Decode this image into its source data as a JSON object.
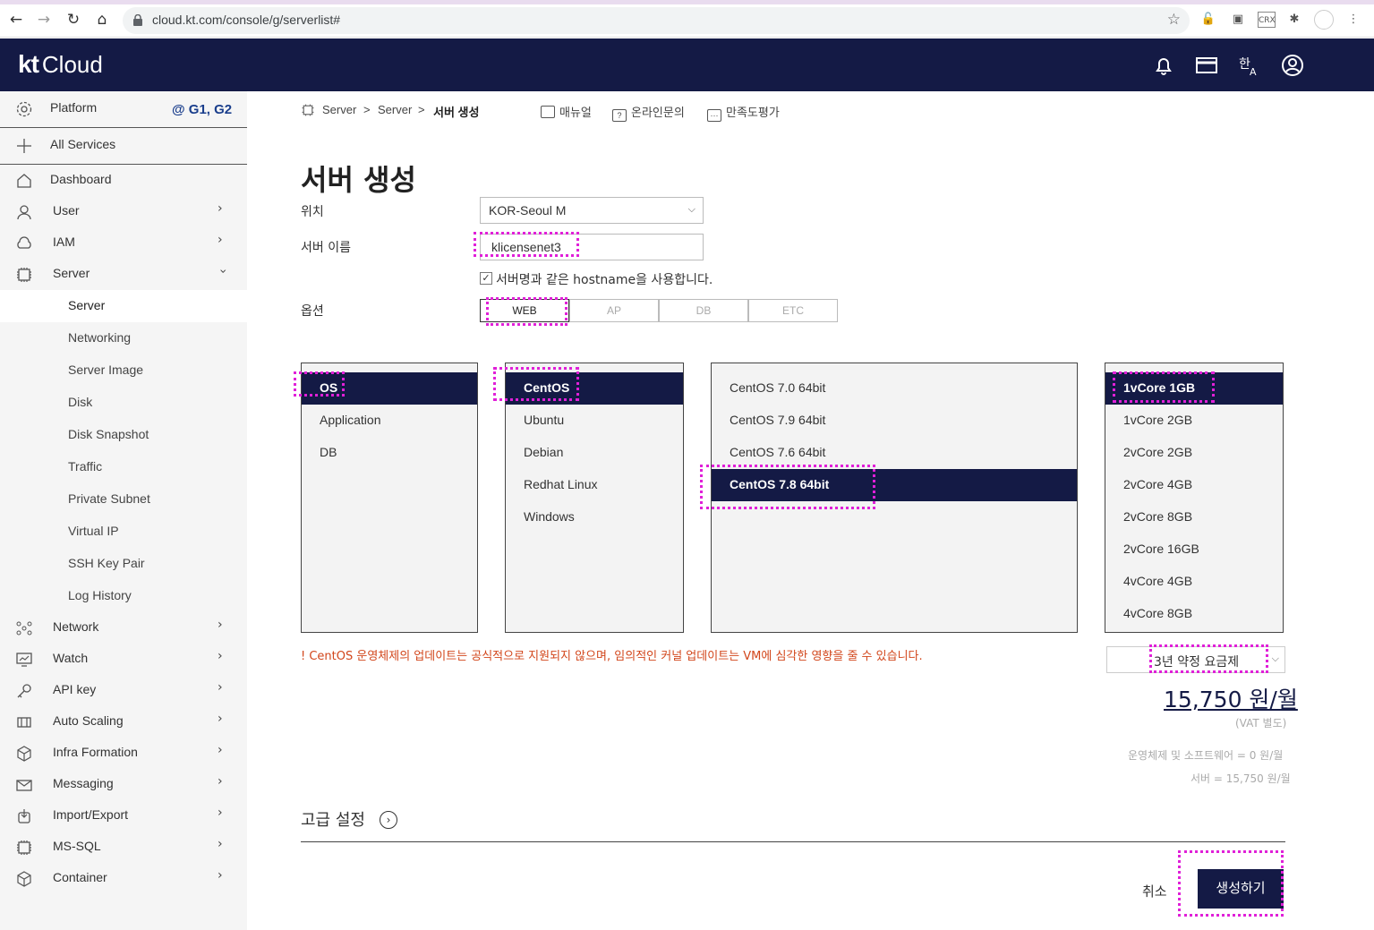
{
  "browser": {
    "url": "cloud.kt.com/console/g/serverlist#",
    "ext_crx": "CRX"
  },
  "header": {
    "logo_kt": "kt",
    "logo_cloud": "Cloud"
  },
  "sidebar": {
    "platform_label": "Platform",
    "platform_gen": "@ G1, G2",
    "all_services": "All Services",
    "items": [
      {
        "label": "Dashboard",
        "icon": "home-icon"
      },
      {
        "label": "User",
        "icon": "user-icon"
      },
      {
        "label": "IAM",
        "icon": "cloud-key-icon"
      },
      {
        "label": "Server",
        "icon": "chip-icon"
      }
    ],
    "server_sub": [
      "Server",
      "Networking",
      "Server Image",
      "Disk",
      "Disk Snapshot",
      "Traffic",
      "Private Subnet",
      "Virtual IP",
      "SSH Key Pair",
      "Log History"
    ],
    "bottom_items": [
      {
        "label": "Network",
        "icon": "network-icon"
      },
      {
        "label": "Watch",
        "icon": "monitor-icon"
      },
      {
        "label": "API key",
        "icon": "key-icon"
      },
      {
        "label": "Auto Scaling",
        "icon": "scaling-icon"
      },
      {
        "label": "Infra Formation",
        "icon": "cube-icon"
      },
      {
        "label": "Messaging",
        "icon": "mail-icon"
      },
      {
        "label": "Import/Export",
        "icon": "import-icon"
      },
      {
        "label": "MS-SQL",
        "icon": "chip-icon"
      },
      {
        "label": "Container",
        "icon": "container-icon"
      }
    ]
  },
  "breadcrumb": {
    "items": [
      "Server",
      "Server",
      "서버 생성"
    ],
    "sep": ">",
    "links": [
      "매뉴얼",
      "온라인문의",
      "만족도평가"
    ]
  },
  "form": {
    "title": "서버 생성",
    "location_label": "위치",
    "location_value": "KOR-Seoul M",
    "name_label": "서버 이름",
    "name_value": "klicensenet3",
    "hostname_check": "서버명과 같은 hostname을 사용합니다.",
    "option_label": "옵션",
    "options": [
      "WEB",
      "AP",
      "DB",
      "ETC"
    ]
  },
  "panels": {
    "category": [
      "OS",
      "Application",
      "DB"
    ],
    "os": [
      "CentOS",
      "Ubuntu",
      "Debian",
      "Redhat Linux",
      "Windows"
    ],
    "version": [
      "CentOS 7.0 64bit",
      "CentOS 7.9 64bit",
      "CentOS 7.6 64bit",
      "CentOS 7.8 64bit"
    ],
    "spec": [
      "1vCore 1GB",
      "1vCore 2GB",
      "2vCore 2GB",
      "2vCore 4GB",
      "2vCore 8GB",
      "2vCore 16GB",
      "4vCore 4GB",
      "4vCore 8GB"
    ]
  },
  "pricing": {
    "warning": "! CentOS 운영체제의 업데이트는 공식적으로 지원되지 않으며, 임의적인 커널 업데이트는 VM에 심각한 영향을 줄 수 있습니다.",
    "plan": "3년 약정 요금제",
    "price": "15,750 원/월",
    "vat": "(VAT 별도)",
    "os_sw": "운영체제 및 소프트웨어 = 0 원/월",
    "server": "서버 = 15,750 원/월"
  },
  "footer": {
    "advanced": "고급 설정",
    "cancel": "취소",
    "create": "생성하기"
  },
  "colors": {
    "navy": "#141a45",
    "highlight": "#e020d8",
    "warning": "#d2461b"
  }
}
